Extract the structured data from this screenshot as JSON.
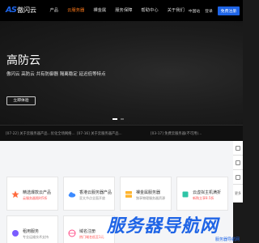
{
  "header": {
    "logo_mark": "AS",
    "logo_text": "傲闪云",
    "nav": [
      "产品",
      "云服务器",
      "裸金属",
      "服务保障",
      "帮助中心",
      "关于我们"
    ],
    "active_nav": "云服务器",
    "lang": "中国站",
    "login": "登录",
    "register": "免费注册"
  },
  "hero": {
    "title": "高防云",
    "subtitle": "傲闪云 高防云 共有防御器 隔离稳定 延迟低等特点",
    "button": "立即体验"
  },
  "news": [
    "[07-22] 关于云服务器产品...优化全场网络...",
    "[07-16] 关于云服务器产品...",
    "[03-17] 免费云服务器(不可用)..."
  ],
  "cards": [
    {
      "title": "精选爆款云产品",
      "desc": "云服务器限时5折",
      "hot": true,
      "icon": "star-icon",
      "color": "#ff6a3d"
    },
    {
      "title": "香港云服务器产品",
      "desc": "亚太节点全面开放",
      "hot": false,
      "icon": "cloud-icon",
      "color": "#3d8bff"
    },
    {
      "title": "裸金属服务器",
      "desc": "独享物理服务器资源",
      "hot": false,
      "icon": "server-icon",
      "color": "#ffb42e"
    },
    {
      "title": "云虚拟主机满折",
      "desc": "新购立享8.5折",
      "hot": true,
      "icon": "box-icon",
      "color": "#2ec4a6"
    },
    {
      "title": "租用服务",
      "desc": "专业运维技术支持",
      "hot": false,
      "icon": "support-icon",
      "color": "#7a5cff"
    },
    {
      "title": "域名注册",
      "desc": "热门域名低至1元",
      "hot": true,
      "icon": "globe-icon",
      "color": "#ff4d88"
    }
  ],
  "side": {
    "more": "更多"
  },
  "watermark": {
    "big": "服务器导航网",
    "small": "服务器导航网"
  },
  "colors": {
    "brand": "#1e64e6",
    "accent": "#ff7a1a"
  }
}
